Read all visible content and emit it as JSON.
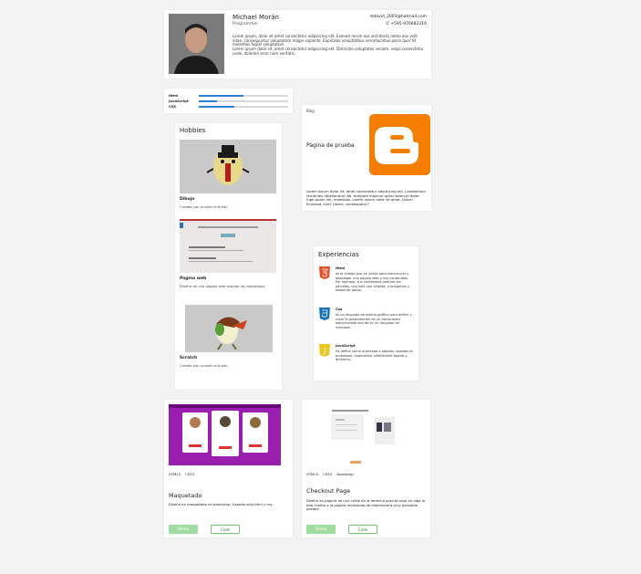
{
  "profile": {
    "name": "Michael Morán",
    "role": "Programmer",
    "email": "david_2003@hotmail.com",
    "phone": "+595-976682316",
    "bio_1": "Lorem ipsum, dolor sit amet consectetur adipisicing elit. Eveniet rerum eos architecto nemo eos velit vitae, consequuntur voluptatem magni sapiente. Explicabo voluptatibus verorducimus porro quo? Et molestias fugiat voluptatum.",
    "bio_2": "Lorem ipsum dolor sit, amet consectetur adipisicing elit. Distinctio voluptates veniam, sequi consectetur unde, dolorem error nam veritatis."
  },
  "skills": [
    {
      "label": "Html",
      "level": 0.5
    },
    {
      "label": "JavaScript",
      "level": 0.2
    },
    {
      "label": "CSS",
      "level": 0.4
    }
  ],
  "blog": {
    "tag": "Blog",
    "title": "Pagina de prueba",
    "text": "Lorem ipsum dolor sit, amet consectetur adipisicing elit. Laudantium reiciendis repellendus! Ab, tempore maxime quasi laborum dolor fuga quam vel, molestias. Lorem ipsum dolor sit amet, Dolor! Eiusmod, sint? Libero, consequatur?"
  },
  "hobbies": {
    "title": "Hobbies",
    "items": [
      {
        "name": "Dibujo",
        "desc": "Creado con scratch.mit.edu"
      },
      {
        "name": "Pagina web",
        "desc": "Diseño de una pagina web usando los arquetipos"
      },
      {
        "name": "Scratch",
        "desc": "Creado con scratch.mit.edu"
      }
    ]
  },
  "experience": {
    "title": "Experiencias",
    "items": [
      {
        "name": "Html",
        "icon": "html5-icon",
        "color": "#e44d26",
        "text": "es el código que se utiliza para estructurar y desplegar una página web y sus contenidos. Por ejemplo, sus contenidos podrían ser párrafos, una lista con viñetas, o imágenes y tablas de datos."
      },
      {
        "name": "Css",
        "icon": "css3-icon",
        "color": "#1572b6",
        "text": "es un lenguaje de diseño gráfico para definir y crear la presentación de un documento estructurado escrito en un lenguaje de marcado."
      },
      {
        "name": "JavaScript",
        "icon": "js-icon",
        "color": "#f0c419",
        "text": "Se define como orientado a objetos, basado en prototipos, imperativo, débilmente tipado y dinámico."
      }
    ]
  },
  "projects": [
    {
      "tags": "HTML5 CSS3",
      "title": "Maquetado",
      "desc": "Diseño en maquetado en bootstrap. Usando solo html y css.",
      "demo": "Demo",
      "code": "Code"
    },
    {
      "tags": "HTML5 CSS3 Bootstrap",
      "title": "Checkout Page",
      "desc": "Diseño en pagina de una celda de la derecha gracias bajo en algo la tela cluebo a la pagina realizando de estemanera muy pensable posible.",
      "demo": "Demo",
      "code": "Code"
    }
  ],
  "colors": {
    "accent": "#2f7fd1",
    "demo": "#9fdc9f",
    "code_border": "#6ec96e",
    "blogger": "#f57d00",
    "purple": "#9b1fae"
  }
}
